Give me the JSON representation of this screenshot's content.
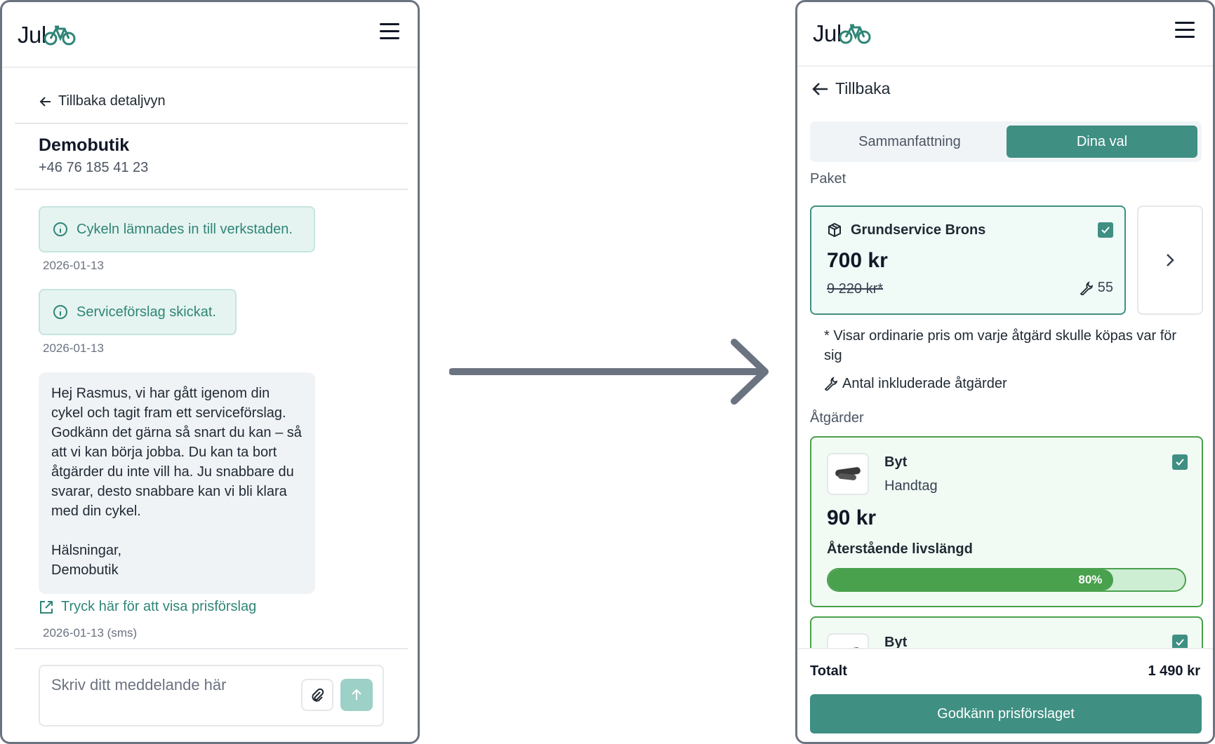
{
  "colors": {
    "accent": "#3f8f83",
    "success": "#49a04d",
    "info_bg": "#e6f4f1",
    "arrow": "#6b7280"
  },
  "left": {
    "logo": {
      "text": "Jul",
      "icon": "bike-icon"
    },
    "back_label": "Tillbaka detaljvyn",
    "shop": {
      "name": "Demobutik",
      "phone": "+46 76 185 41 23"
    },
    "events": [
      {
        "text": "Cykeln lämnades in till verkstaden.",
        "date": "2026-01-13",
        "icon": "info-icon"
      },
      {
        "text": "Serviceförslag skickat.",
        "date": "2026-01-13",
        "icon": "info-icon"
      }
    ],
    "message": {
      "body": "Hej Rasmus, vi har gått igenom din cykel och tagit fram ett serviceförslag. Godkänn det gärna så snart du kan – så att vi kan börja jobba. Du kan ta bort åtgärder du inte vill ha. Ju snabbare du svarar, desto snabbare kan vi bli klara med din cykel.",
      "greeting": "Hälsningar,",
      "signature": "Demobutik"
    },
    "price_link": "Tryck här för att visa prisförslag",
    "sms_date": "2026-01-13 (sms)",
    "composer": {
      "placeholder": "Skriv ditt meddelande här"
    }
  },
  "right": {
    "logo": {
      "text": "Jul",
      "icon": "bike-icon"
    },
    "back_label": "Tillbaka",
    "tabs": [
      {
        "label": "Sammanfattning",
        "active": false
      },
      {
        "label": "Dina val",
        "active": true
      }
    ],
    "package_section": "Paket",
    "package": {
      "title": "Grundservice Brons",
      "price": "700 kr",
      "original_price": "9 220 kr*",
      "included_count": "55",
      "checked": true
    },
    "notes": {
      "asterisk": "* Visar ordinarie pris om varje åtgärd skulle köpas var för sig",
      "count": "Antal inkluderade åtgärder"
    },
    "actions_section": "Åtgärder",
    "actions": [
      {
        "verb": "Byt",
        "item": "Handtag",
        "price": "90 kr",
        "life_label": "Återstående livslängd",
        "life_percent": 80,
        "life_text": "80%",
        "checked": true
      },
      {
        "verb": "Byt",
        "checked": true
      }
    ],
    "total": {
      "label": "Totalt",
      "value": "1 490 kr"
    },
    "approve_label": "Godkänn prisförslaget"
  }
}
